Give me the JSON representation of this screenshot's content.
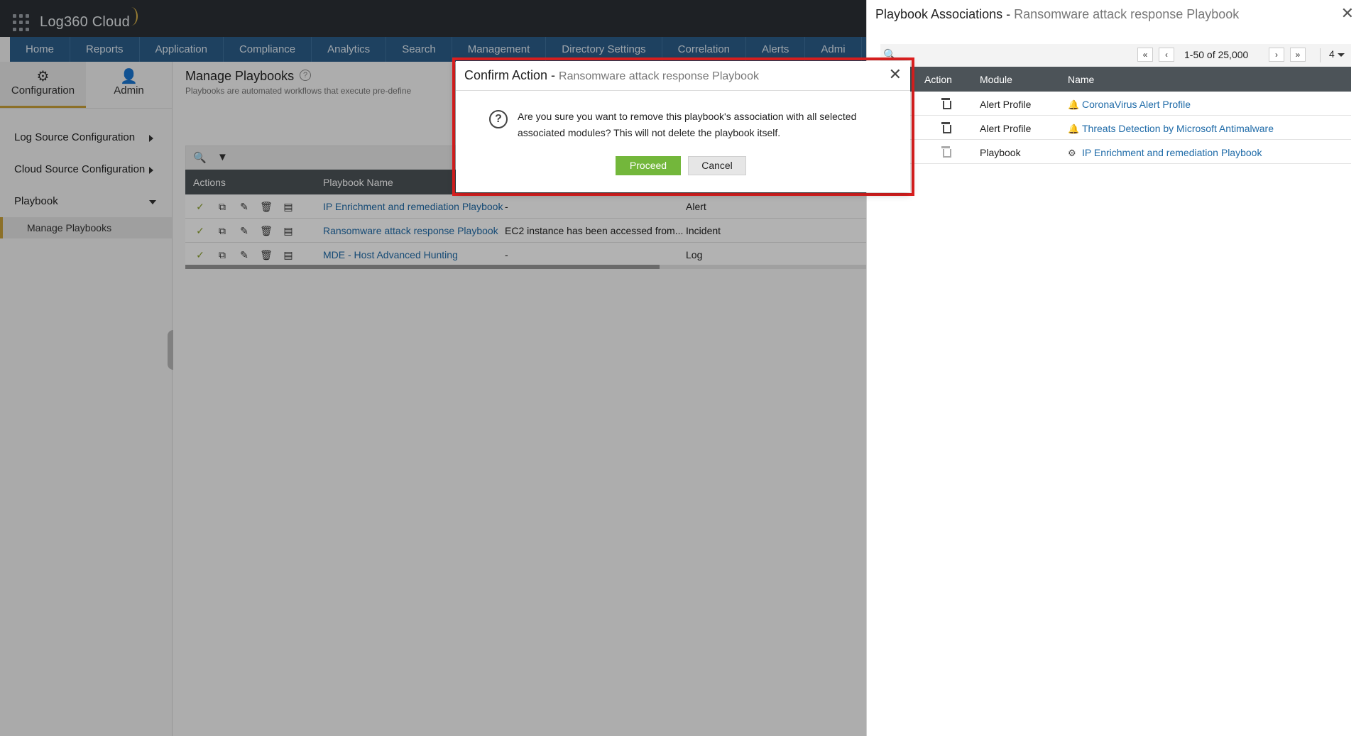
{
  "app": {
    "logo": "Log360 Cloud"
  },
  "nav": [
    "Home",
    "Reports",
    "Application",
    "Compliance",
    "Analytics",
    "Search",
    "Management",
    "Directory Settings",
    "Correlation",
    "Alerts",
    "Admi"
  ],
  "sidebar": {
    "tabs": [
      {
        "label": "Configuration",
        "icon": "gear-icon",
        "active": true
      },
      {
        "label": "Admin",
        "icon": "user-icon",
        "active": false
      }
    ],
    "items": [
      {
        "label": "Log Source Configuration"
      },
      {
        "label": "Cloud Source Configuration"
      },
      {
        "label": "Playbook"
      }
    ],
    "sub_item": "Manage Playbooks"
  },
  "main": {
    "title": "Manage Playbooks",
    "description": "Playbooks are automated workflows that execute pre-define",
    "columns": [
      "Actions",
      "Playbook Name"
    ],
    "rows": [
      {
        "name": "IP Enrichment and remediation Playbook",
        "desc": "-",
        "type": "Alert"
      },
      {
        "name": "Ransomware attack response Playbook",
        "desc": "EC2 instance has been accessed from...",
        "type": "Incident"
      },
      {
        "name": "MDE - Host Advanced Hunting",
        "desc": "-",
        "type": "Log"
      }
    ]
  },
  "panel": {
    "title": "Playbook Associations - ",
    "subtitle": "Ransomware attack response Playbook",
    "pager": {
      "range": "1-50 of 25,000",
      "page_size": "4"
    },
    "columns": [
      "Action",
      "Module",
      "Name"
    ],
    "rows": [
      {
        "module": "Alert Profile",
        "name": "CoronaVirus Alert Profile",
        "icon": "bell-icon"
      },
      {
        "module": "Alert Profile",
        "name": "Threats Detection by Microsoft Antimalware",
        "icon": "bell-icon"
      },
      {
        "module": "Playbook",
        "name": "IP Enrichment and remediation Playbook",
        "icon": "playbook-icon"
      }
    ]
  },
  "modal": {
    "title": "Confirm Action - ",
    "subtitle": "Ransomware attack response Playbook",
    "message": "Are you sure you want to remove this playbook's association with all selected associated modules? This will not delete the playbook itself.",
    "proceed": "Proceed",
    "cancel": "Cancel",
    "highlight_color": "#e02020"
  }
}
